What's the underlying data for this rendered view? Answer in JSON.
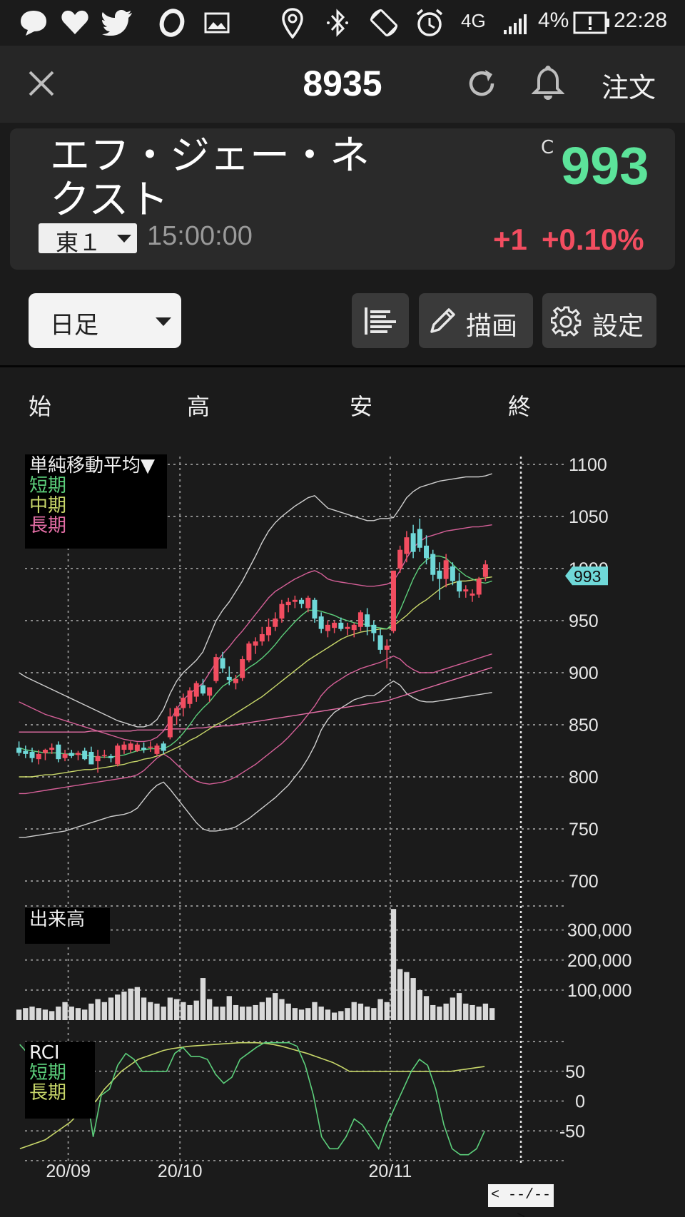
{
  "status_bar": {
    "icons": [
      "chat-bubble-icon",
      "heart-icon",
      "twitter-bird-icon",
      "o-app-icon",
      "image-icon",
      "location-pin-icon",
      "bluetooth-icon",
      "screen-rotate-icon",
      "alarm-clock-icon",
      "signal-icon",
      "battery-alert-icon"
    ],
    "network": "4G",
    "battery": "4%",
    "time": "22:28"
  },
  "header": {
    "close_icon": "close-icon",
    "title": "8935",
    "refresh_icon": "refresh-icon",
    "alert_icon": "bell-icon",
    "order_label": "注文"
  },
  "quote": {
    "name_line1": "エフ・ジェー・ネ",
    "name_line2": "クスト",
    "market": "東１",
    "time": "15:00:00",
    "price_flag": "C",
    "price": "993",
    "change": "+1",
    "change_pct": "+0.10%",
    "up_color": "#5ce39a",
    "down_color": "#f24d60"
  },
  "toolbar": {
    "period": "日足",
    "draw_label": "描画",
    "settings_label": "設定",
    "menu_icon": "bars-icon",
    "pencil_icon": "pencil-icon",
    "gear_icon": "gear-icon"
  },
  "ohlc_header": {
    "open": "始",
    "high": "高",
    "low": "安",
    "close": "終"
  },
  "indicator_legends": {
    "sma_title": "単純移動平均▼",
    "sma_short": "短期",
    "sma_mid": "中期",
    "sma_long": "長期",
    "volume_title": "出来高",
    "rci_title": "RCI",
    "rci_short": "短期",
    "rci_long": "長期"
  },
  "navigation": {
    "range_label": "< --/-- >"
  },
  "chart_data": {
    "type": "candlestick",
    "price_panel": {
      "y_ticks": [
        "1100",
        "1050",
        "1000",
        "950",
        "900",
        "850",
        "800",
        "750",
        "700"
      ],
      "ylim": [
        700,
        1100
      ],
      "current_price_tag": "993",
      "candle_colors": {
        "up": "#f24d60",
        "down": "#6fd8d8"
      },
      "candles": [
        {
          "o": 828,
          "h": 834,
          "l": 820,
          "c": 823
        },
        {
          "o": 825,
          "h": 830,
          "l": 818,
          "c": 822
        },
        {
          "o": 824,
          "h": 828,
          "l": 814,
          "c": 818
        },
        {
          "o": 817,
          "h": 826,
          "l": 812,
          "c": 822
        },
        {
          "o": 823,
          "h": 827,
          "l": 816,
          "c": 826
        },
        {
          "o": 826,
          "h": 832,
          "l": 822,
          "c": 828
        },
        {
          "o": 831,
          "h": 834,
          "l": 814,
          "c": 817
        },
        {
          "o": 818,
          "h": 826,
          "l": 815,
          "c": 822
        },
        {
          "o": 823,
          "h": 826,
          "l": 818,
          "c": 820
        },
        {
          "o": 821,
          "h": 825,
          "l": 816,
          "c": 823
        },
        {
          "o": 825,
          "h": 828,
          "l": 816,
          "c": 817
        },
        {
          "o": 824,
          "h": 829,
          "l": 812,
          "c": 812
        },
        {
          "o": 815,
          "h": 826,
          "l": 804,
          "c": 820
        },
        {
          "o": 820,
          "h": 826,
          "l": 818,
          "c": 821
        },
        {
          "o": 820,
          "h": 822,
          "l": 814,
          "c": 818
        },
        {
          "o": 812,
          "h": 832,
          "l": 810,
          "c": 830
        },
        {
          "o": 826,
          "h": 834,
          "l": 822,
          "c": 831
        },
        {
          "o": 826,
          "h": 834,
          "l": 823,
          "c": 832
        },
        {
          "o": 825,
          "h": 833,
          "l": 824,
          "c": 831
        },
        {
          "o": 828,
          "h": 833,
          "l": 823,
          "c": 826
        },
        {
          "o": 828,
          "h": 834,
          "l": 824,
          "c": 829
        },
        {
          "o": 822,
          "h": 832,
          "l": 820,
          "c": 830
        },
        {
          "o": 832,
          "h": 834,
          "l": 822,
          "c": 825
        },
        {
          "o": 838,
          "h": 866,
          "l": 836,
          "c": 858
        },
        {
          "o": 858,
          "h": 868,
          "l": 850,
          "c": 866
        },
        {
          "o": 866,
          "h": 880,
          "l": 858,
          "c": 876
        },
        {
          "o": 870,
          "h": 886,
          "l": 866,
          "c": 883
        },
        {
          "o": 877,
          "h": 892,
          "l": 872,
          "c": 890
        },
        {
          "o": 888,
          "h": 894,
          "l": 878,
          "c": 880
        },
        {
          "o": 878,
          "h": 886,
          "l": 872,
          "c": 886
        },
        {
          "o": 892,
          "h": 918,
          "l": 890,
          "c": 915
        },
        {
          "o": 914,
          "h": 920,
          "l": 900,
          "c": 904
        },
        {
          "o": 896,
          "h": 906,
          "l": 888,
          "c": 893
        },
        {
          "o": 890,
          "h": 898,
          "l": 884,
          "c": 894
        },
        {
          "o": 895,
          "h": 916,
          "l": 892,
          "c": 913
        },
        {
          "o": 912,
          "h": 930,
          "l": 910,
          "c": 928
        },
        {
          "o": 926,
          "h": 934,
          "l": 918,
          "c": 930
        },
        {
          "o": 930,
          "h": 944,
          "l": 926,
          "c": 937
        },
        {
          "o": 936,
          "h": 952,
          "l": 930,
          "c": 944
        },
        {
          "o": 944,
          "h": 958,
          "l": 940,
          "c": 952
        },
        {
          "o": 952,
          "h": 970,
          "l": 948,
          "c": 966
        },
        {
          "o": 965,
          "h": 972,
          "l": 958,
          "c": 968
        },
        {
          "o": 968,
          "h": 974,
          "l": 962,
          "c": 970
        },
        {
          "o": 970,
          "h": 972,
          "l": 962,
          "c": 966
        },
        {
          "o": 962,
          "h": 974,
          "l": 958,
          "c": 972
        },
        {
          "o": 970,
          "h": 972,
          "l": 948,
          "c": 952
        },
        {
          "o": 954,
          "h": 958,
          "l": 938,
          "c": 942
        },
        {
          "o": 940,
          "h": 950,
          "l": 934,
          "c": 946
        },
        {
          "o": 943,
          "h": 950,
          "l": 938,
          "c": 948
        },
        {
          "o": 948,
          "h": 953,
          "l": 940,
          "c": 942
        },
        {
          "o": 942,
          "h": 948,
          "l": 936,
          "c": 944
        },
        {
          "o": 941,
          "h": 948,
          "l": 934,
          "c": 946
        },
        {
          "o": 944,
          "h": 960,
          "l": 940,
          "c": 958
        },
        {
          "o": 956,
          "h": 962,
          "l": 936,
          "c": 944
        },
        {
          "o": 946,
          "h": 950,
          "l": 930,
          "c": 938
        },
        {
          "o": 936,
          "h": 942,
          "l": 918,
          "c": 922
        },
        {
          "o": 922,
          "h": 932,
          "l": 904,
          "c": 926
        },
        {
          "o": 940,
          "h": 998,
          "l": 938,
          "c": 998
        },
        {
          "o": 1000,
          "h": 1022,
          "l": 996,
          "c": 1018
        },
        {
          "o": 1014,
          "h": 1036,
          "l": 1006,
          "c": 1030
        },
        {
          "o": 1034,
          "h": 1042,
          "l": 1010,
          "c": 1016
        },
        {
          "o": 1038,
          "h": 1048,
          "l": 1016,
          "c": 1020
        },
        {
          "o": 1022,
          "h": 1032,
          "l": 1004,
          "c": 1010
        },
        {
          "o": 1014,
          "h": 1018,
          "l": 988,
          "c": 994
        },
        {
          "o": 998,
          "h": 1006,
          "l": 970,
          "c": 990
        },
        {
          "o": 990,
          "h": 1014,
          "l": 982,
          "c": 1008
        },
        {
          "o": 1002,
          "h": 1006,
          "l": 984,
          "c": 988
        },
        {
          "o": 988,
          "h": 996,
          "l": 972,
          "c": 978
        },
        {
          "o": 978,
          "h": 984,
          "l": 972,
          "c": 980
        },
        {
          "o": 974,
          "h": 980,
          "l": 968,
          "c": 976
        },
        {
          "o": 975,
          "h": 992,
          "l": 972,
          "c": 990
        },
        {
          "o": 992,
          "h": 1008,
          "l": 988,
          "c": 1004
        }
      ],
      "sma_short": [
        828,
        826,
        825,
        824,
        823,
        823,
        823,
        822,
        822,
        822,
        821,
        820,
        819,
        819,
        819,
        820,
        821,
        823,
        825,
        826,
        827,
        827,
        827,
        830,
        835,
        842,
        850,
        859,
        866,
        872,
        880,
        887,
        891,
        895,
        900,
        905,
        909,
        914,
        920,
        927,
        935,
        942,
        949,
        955,
        960,
        960,
        959,
        957,
        955,
        952,
        950,
        948,
        947,
        946,
        944,
        943,
        942,
        948,
        960,
        975,
        990,
        1002,
        1008,
        1012,
        1012,
        1010,
        1004,
        998,
        993,
        990,
        987,
        986,
        988
      ],
      "sma_mid": [
        800,
        800,
        800,
        801,
        802,
        802,
        803,
        804,
        805,
        806,
        807,
        807,
        808,
        809,
        810,
        811,
        812,
        814,
        815,
        817,
        818,
        820,
        822,
        825,
        828,
        831,
        835,
        838,
        842,
        846,
        850,
        853,
        857,
        861,
        865,
        869,
        873,
        877,
        882,
        887,
        892,
        897,
        902,
        907,
        912,
        916,
        920,
        924,
        928,
        932,
        935,
        937,
        939,
        940,
        941,
        942,
        942,
        945,
        950,
        955,
        961,
        966,
        970,
        975,
        980,
        984,
        986,
        988,
        988,
        989,
        990,
        991,
        992
      ],
      "sma_long": [
        843,
        843,
        843,
        843,
        843,
        843,
        843,
        843,
        843,
        843,
        843,
        844,
        844,
        844,
        844,
        844,
        844,
        844,
        845,
        845,
        845,
        845,
        845,
        846,
        846,
        846,
        846,
        847,
        847,
        848,
        848,
        849,
        849,
        850,
        851,
        852,
        853,
        854,
        855,
        856,
        857,
        858,
        859,
        860,
        861,
        862,
        863,
        864,
        865,
        866,
        867,
        868,
        869,
        870,
        871,
        872,
        873,
        875,
        877,
        879,
        881,
        883,
        885,
        887,
        889,
        891,
        893,
        895,
        897,
        899,
        901,
        903,
        905
      ],
      "band_upper_outer": [
        900,
        896,
        893,
        890,
        887,
        884,
        881,
        878,
        875,
        872,
        869,
        866,
        863,
        860,
        857,
        854,
        852,
        850,
        848,
        848,
        850,
        855,
        865,
        880,
        892,
        900,
        906,
        912,
        920,
        935,
        950,
        960,
        968,
        978,
        988,
        1000,
        1012,
        1025,
        1036,
        1044,
        1050,
        1055,
        1060,
        1064,
        1068,
        1070,
        1064,
        1058,
        1056,
        1054,
        1052,
        1050,
        1048,
        1046,
        1046,
        1048,
        1048,
        1049,
        1058,
        1068,
        1074,
        1078,
        1080,
        1082,
        1084,
        1085,
        1086,
        1087,
        1088,
        1088,
        1088,
        1089,
        1091
      ],
      "band_lower_outer": [
        742,
        742,
        743,
        744,
        745,
        746,
        747,
        748,
        750,
        752,
        754,
        756,
        758,
        760,
        762,
        763,
        764,
        766,
        770,
        778,
        786,
        792,
        795,
        788,
        780,
        772,
        764,
        756,
        750,
        748,
        748,
        749,
        750,
        752,
        756,
        760,
        765,
        770,
        775,
        780,
        786,
        792,
        800,
        808,
        818,
        830,
        845,
        855,
        862,
        866,
        870,
        874,
        876,
        878,
        878,
        882,
        888,
        892,
        888,
        880,
        876,
        873,
        872,
        872,
        873,
        874,
        875,
        876,
        877,
        878,
        879,
        880,
        881
      ],
      "band_upper_inner": [
        872,
        869,
        866,
        863,
        860,
        858,
        856,
        854,
        852,
        850,
        848,
        846,
        844,
        842,
        840,
        838,
        836,
        835,
        834,
        834,
        835,
        838,
        844,
        854,
        865,
        874,
        880,
        885,
        890,
        900,
        910,
        918,
        925,
        933,
        940,
        948,
        956,
        964,
        972,
        978,
        982,
        986,
        990,
        993,
        996,
        998,
        995,
        990,
        988,
        987,
        986,
        985,
        984,
        983,
        983,
        984,
        985,
        988,
        998,
        1010,
        1020,
        1026,
        1030,
        1032,
        1034,
        1036,
        1037,
        1038,
        1039,
        1040,
        1040,
        1041,
        1042
      ],
      "band_lower_inner": [
        784,
        784,
        785,
        786,
        787,
        788,
        789,
        790,
        791,
        792,
        793,
        794,
        795,
        796,
        797,
        798,
        799,
        800,
        802,
        806,
        812,
        818,
        822,
        818,
        812,
        806,
        800,
        796,
        794,
        793,
        794,
        795,
        797,
        800,
        804,
        808,
        812,
        817,
        822,
        827,
        832,
        838,
        845,
        852,
        860,
        868,
        878,
        885,
        890,
        894,
        898,
        901,
        904,
        906,
        908,
        910,
        913,
        916,
        913,
        907,
        903,
        900,
        900,
        900,
        902,
        904,
        906,
        908,
        910,
        912,
        914,
        916,
        918
      ]
    },
    "volume_panel": {
      "title": "出来高",
      "y_ticks": [
        "300,000",
        "200,000",
        "100,000"
      ],
      "values": [
        35000,
        40000,
        45000,
        40000,
        35000,
        30000,
        45000,
        60000,
        45000,
        40000,
        35000,
        55000,
        70000,
        60000,
        75000,
        85000,
        95000,
        105000,
        110000,
        75000,
        60000,
        55000,
        45000,
        75000,
        70000,
        60000,
        50000,
        65000,
        140000,
        70000,
        45000,
        45000,
        80000,
        50000,
        45000,
        45000,
        50000,
        60000,
        75000,
        90000,
        70000,
        55000,
        40000,
        35000,
        40000,
        60000,
        45000,
        35000,
        25000,
        30000,
        40000,
        60000,
        55000,
        45000,
        40000,
        70000,
        60000,
        370000,
        170000,
        160000,
        140000,
        100000,
        80000,
        50000,
        45000,
        55000,
        75000,
        90000,
        55000,
        50000,
        45000,
        55000,
        40000
      ],
      "ylim": [
        0,
        380000
      ]
    },
    "rci_panel": {
      "y_ticks": [
        "50",
        "0",
        "-50"
      ],
      "ylim": [
        -100,
        100
      ],
      "short": [
        95,
        80,
        40,
        10,
        0,
        -20,
        -10,
        20,
        30,
        -60,
        10,
        20,
        60,
        80,
        70,
        50,
        50,
        50,
        50,
        80,
        90,
        75,
        75,
        70,
        45,
        30,
        40,
        70,
        80,
        90,
        98,
        98,
        98,
        98,
        92,
        60,
        10,
        -60,
        -80,
        -80,
        -60,
        -30,
        -40,
        -60,
        -80,
        -40,
        -10,
        20,
        50,
        70,
        60,
        20,
        -40,
        -80,
        -90,
        -90,
        -80,
        -50
      ],
      "long": [
        -80,
        -75,
        -70,
        -65,
        -55,
        -45,
        -35,
        -20,
        -10,
        0,
        20,
        35,
        50,
        60,
        70,
        75,
        80,
        85,
        88,
        90,
        92,
        93,
        94,
        95,
        96,
        97,
        98,
        98,
        98,
        97,
        95,
        92,
        88,
        84,
        80,
        75,
        70,
        65,
        58,
        50,
        50,
        50,
        50,
        50,
        50,
        50,
        50,
        50,
        50,
        50,
        50,
        50,
        52,
        54,
        56,
        58
      ],
      "rci_colors": {
        "short": "#5ccf7b",
        "long": "#c9d86a"
      }
    },
    "x_labels": [
      "20/09",
      "20/10",
      "20/11"
    ]
  }
}
